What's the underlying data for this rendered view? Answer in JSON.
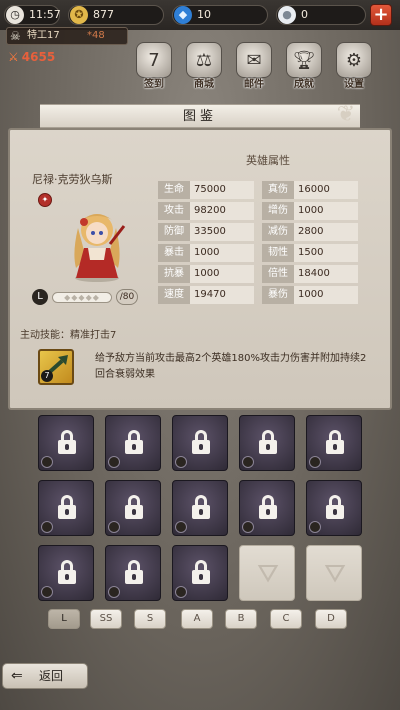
{
  "status": {
    "time": "11:57",
    "gold": "877",
    "gems": "10",
    "pearls": "0"
  },
  "player": {
    "name": "特工17",
    "level": "48",
    "power": "4655"
  },
  "menu": [
    {
      "label": "签到",
      "icon": "calendar-icon"
    },
    {
      "label": "商城",
      "icon": "scales-icon"
    },
    {
      "label": "邮件",
      "icon": "mail-icon"
    },
    {
      "label": "成就",
      "icon": "trophy-icon"
    },
    {
      "label": "设置",
      "icon": "gear-icon"
    }
  ],
  "page": {
    "title": "图鉴"
  },
  "hero": {
    "name": "尼禄·克劳狄乌斯",
    "attr_title": "英雄属性",
    "rank": "L",
    "star_count": "/80",
    "stats": [
      {
        "k1": "生命",
        "v1": "75000",
        "k2": "真伤",
        "v2": "16000"
      },
      {
        "k1": "攻击",
        "v1": "98200",
        "k2": "增伤",
        "v2": "1000"
      },
      {
        "k1": "防御",
        "v1": "33500",
        "k2": "减伤",
        "v2": "2800"
      },
      {
        "k1": "暴击",
        "v1": "1000",
        "k2": "韧性",
        "v2": "1500"
      },
      {
        "k1": "抗暴",
        "v1": "1000",
        "k2": "倍性",
        "v2": "18400"
      },
      {
        "k1": "速度",
        "v1": "19470",
        "k2": "暴伤",
        "v2": "1000"
      }
    ]
  },
  "skill": {
    "title": "主动技能：精准打击7",
    "level": "7",
    "description": "给予敌方当前攻击最高2个英雄180%攻击力伤害并附加持续2回合衰弱效果"
  },
  "grades": [
    "L",
    "SS",
    "S",
    "A",
    "B",
    "C",
    "D"
  ],
  "back_label": "返回",
  "colors": {
    "accent": "#c2392a",
    "panel": "#d8d1c6"
  }
}
